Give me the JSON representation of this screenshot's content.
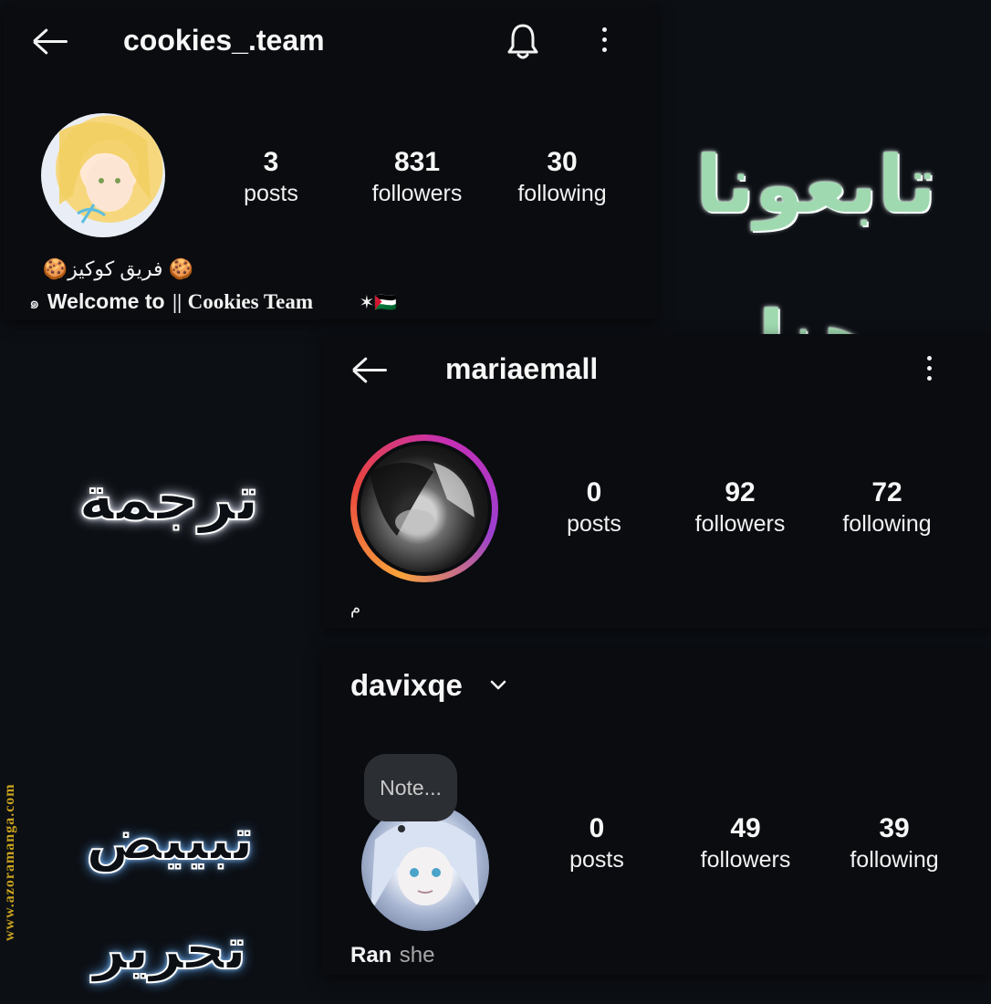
{
  "overlay": {
    "follow_text": "تابعونا هنا",
    "translation_text": "ترجمة",
    "cleaning_text": "تبييض تحرير",
    "watermark": "www.azoramanga.com"
  },
  "profile1": {
    "username": "cookies_.team",
    "stats": [
      {
        "num": "3",
        "label": "posts"
      },
      {
        "num": "831",
        "label": "followers"
      },
      {
        "num": "30",
        "label": "following"
      }
    ],
    "bio_line1": "🍪 فريق كوكيز🍪",
    "bio_line2_prefix": "๑",
    "bio_line2_main": "Welcome to",
    "bio_line2_sep": "||",
    "bio_line2_name": "Cookies Team",
    "bio_line2_suffix": "✶🇵🇸"
  },
  "profile2": {
    "username": "mariaemall",
    "stats": [
      {
        "num": "0",
        "label": "posts"
      },
      {
        "num": "92",
        "label": "followers"
      },
      {
        "num": "72",
        "label": "following"
      }
    ],
    "bio": "م"
  },
  "profile3": {
    "username": "davixqe",
    "note": "Note...",
    "stats": [
      {
        "num": "0",
        "label": "posts"
      },
      {
        "num": "49",
        "label": "followers"
      },
      {
        "num": "39",
        "label": "following"
      }
    ],
    "name": "Ran",
    "pronoun": "she"
  },
  "colors": {
    "background": "#0c0f14",
    "panel": "#0a0c10",
    "story_ring_start": "#f9a33a",
    "story_ring_end": "#c62fb6",
    "follow_text_gradient": [
      "#7fd7d2",
      "#b6d77d"
    ],
    "watermark": "#c9a21e"
  }
}
